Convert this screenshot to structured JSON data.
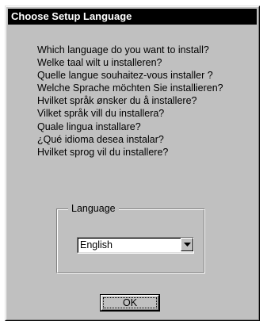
{
  "window": {
    "title": "Choose Setup Language"
  },
  "questions": [
    "Which language do you want to install?",
    "Welke taal wilt u installeren?",
    "Quelle langue souhaitez-vous installer ?",
    "Welche Sprache möchten Sie installieren?",
    "Hvilket språk ønsker du å installere?",
    "Vilket språk vill du installera?",
    "Quale lingua installare?",
    "¿Qué idioma desea instalar?",
    "Hvilket sprog vil du installere?"
  ],
  "language_group": {
    "label": "Language",
    "selected": "English",
    "dropdown_icon": "triangle-down-icon"
  },
  "buttons": {
    "ok_label": "OK"
  },
  "colors": {
    "title_bar": "#000000",
    "dialog_face": "#c0c0c0"
  }
}
